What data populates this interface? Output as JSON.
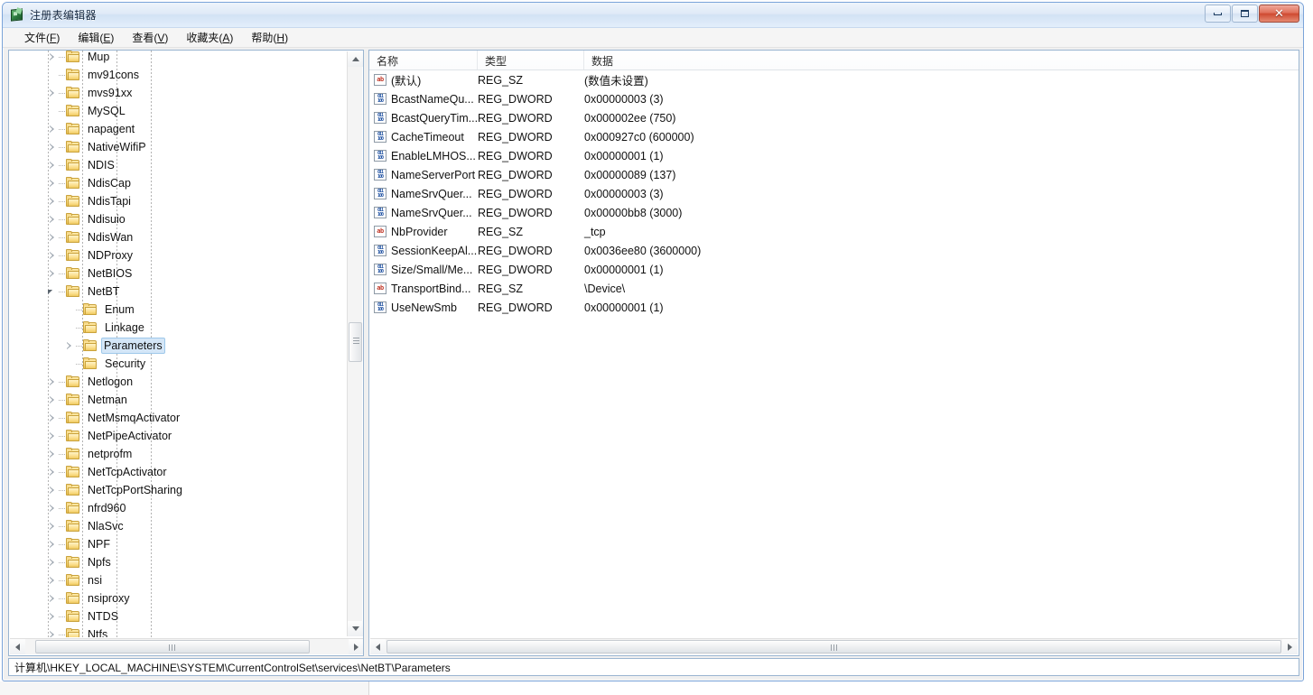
{
  "window": {
    "title": "注册表编辑器",
    "icon": "registry-editor-icon",
    "buttons": {
      "minimize": "",
      "maximize": "",
      "close": "✕"
    }
  },
  "menu": [
    {
      "label": "文件(F)",
      "text": "文件",
      "accel": "F"
    },
    {
      "label": "编辑(E)",
      "text": "编辑",
      "accel": "E"
    },
    {
      "label": "查看(V)",
      "text": "查看",
      "accel": "V"
    },
    {
      "label": "收藏夹(A)",
      "text": "收藏夹",
      "accel": "A"
    },
    {
      "label": "帮助(H)",
      "text": "帮助",
      "accel": "H"
    }
  ],
  "tree": {
    "items": [
      {
        "label": "Mup",
        "depth": 2,
        "twisty": "collapsed",
        "selected": false
      },
      {
        "label": "mv91cons",
        "depth": 2,
        "twisty": "none",
        "selected": false
      },
      {
        "label": "mvs91xx",
        "depth": 2,
        "twisty": "collapsed",
        "selected": false
      },
      {
        "label": "MySQL",
        "depth": 2,
        "twisty": "none",
        "selected": false
      },
      {
        "label": "napagent",
        "depth": 2,
        "twisty": "collapsed",
        "selected": false
      },
      {
        "label": "NativeWifiP",
        "depth": 2,
        "twisty": "collapsed",
        "selected": false
      },
      {
        "label": "NDIS",
        "depth": 2,
        "twisty": "collapsed",
        "selected": false
      },
      {
        "label": "NdisCap",
        "depth": 2,
        "twisty": "collapsed",
        "selected": false
      },
      {
        "label": "NdisTapi",
        "depth": 2,
        "twisty": "collapsed",
        "selected": false
      },
      {
        "label": "Ndisuio",
        "depth": 2,
        "twisty": "collapsed",
        "selected": false
      },
      {
        "label": "NdisWan",
        "depth": 2,
        "twisty": "collapsed",
        "selected": false
      },
      {
        "label": "NDProxy",
        "depth": 2,
        "twisty": "collapsed",
        "selected": false
      },
      {
        "label": "NetBIOS",
        "depth": 2,
        "twisty": "collapsed",
        "selected": false
      },
      {
        "label": "NetBT",
        "depth": 2,
        "twisty": "expanded",
        "selected": false
      },
      {
        "label": "Enum",
        "depth": 3,
        "twisty": "none",
        "selected": false
      },
      {
        "label": "Linkage",
        "depth": 3,
        "twisty": "none",
        "selected": false
      },
      {
        "label": "Parameters",
        "depth": 3,
        "twisty": "collapsed",
        "selected": true
      },
      {
        "label": "Security",
        "depth": 3,
        "twisty": "none",
        "selected": false
      },
      {
        "label": "Netlogon",
        "depth": 2,
        "twisty": "collapsed",
        "selected": false
      },
      {
        "label": "Netman",
        "depth": 2,
        "twisty": "collapsed",
        "selected": false
      },
      {
        "label": "NetMsmqActivator",
        "depth": 2,
        "twisty": "collapsed",
        "selected": false
      },
      {
        "label": "NetPipeActivator",
        "depth": 2,
        "twisty": "collapsed",
        "selected": false
      },
      {
        "label": "netprofm",
        "depth": 2,
        "twisty": "collapsed",
        "selected": false
      },
      {
        "label": "NetTcpActivator",
        "depth": 2,
        "twisty": "collapsed",
        "selected": false
      },
      {
        "label": "NetTcpPortSharing",
        "depth": 2,
        "twisty": "collapsed",
        "selected": false
      },
      {
        "label": "nfrd960",
        "depth": 2,
        "twisty": "collapsed",
        "selected": false
      },
      {
        "label": "NlaSvc",
        "depth": 2,
        "twisty": "collapsed",
        "selected": false
      },
      {
        "label": "NPF",
        "depth": 2,
        "twisty": "collapsed",
        "selected": false
      },
      {
        "label": "Npfs",
        "depth": 2,
        "twisty": "collapsed",
        "selected": false
      },
      {
        "label": "nsi",
        "depth": 2,
        "twisty": "collapsed",
        "selected": false
      },
      {
        "label": "nsiproxy",
        "depth": 2,
        "twisty": "collapsed",
        "selected": false
      },
      {
        "label": "NTDS",
        "depth": 2,
        "twisty": "collapsed",
        "selected": false
      },
      {
        "label": "Ntfs",
        "depth": 2,
        "twisty": "collapsed",
        "selected": false
      }
    ]
  },
  "list": {
    "columns": [
      {
        "label": "名称",
        "key": "name"
      },
      {
        "label": "类型",
        "key": "type"
      },
      {
        "label": "数据",
        "key": "data"
      }
    ],
    "rows": [
      {
        "icon": "string-value-icon",
        "kind": "sz",
        "name": "(默认)",
        "type": "REG_SZ",
        "data": "(数值未设置)"
      },
      {
        "icon": "dword-value-icon",
        "kind": "dw",
        "name": "BcastNameQu...",
        "type": "REG_DWORD",
        "data": "0x00000003 (3)"
      },
      {
        "icon": "dword-value-icon",
        "kind": "dw",
        "name": "BcastQueryTim...",
        "type": "REG_DWORD",
        "data": "0x000002ee (750)"
      },
      {
        "icon": "dword-value-icon",
        "kind": "dw",
        "name": "CacheTimeout",
        "type": "REG_DWORD",
        "data": "0x000927c0 (600000)"
      },
      {
        "icon": "dword-value-icon",
        "kind": "dw",
        "name": "EnableLMHOS...",
        "type": "REG_DWORD",
        "data": "0x00000001 (1)"
      },
      {
        "icon": "dword-value-icon",
        "kind": "dw",
        "name": "NameServerPort",
        "type": "REG_DWORD",
        "data": "0x00000089 (137)"
      },
      {
        "icon": "dword-value-icon",
        "kind": "dw",
        "name": "NameSrvQuer...",
        "type": "REG_DWORD",
        "data": "0x00000003 (3)"
      },
      {
        "icon": "dword-value-icon",
        "kind": "dw",
        "name": "NameSrvQuer...",
        "type": "REG_DWORD",
        "data": "0x00000bb8 (3000)"
      },
      {
        "icon": "string-value-icon",
        "kind": "sz",
        "name": "NbProvider",
        "type": "REG_SZ",
        "data": "_tcp"
      },
      {
        "icon": "dword-value-icon",
        "kind": "dw",
        "name": "SessionKeepAl...",
        "type": "REG_DWORD",
        "data": "0x0036ee80 (3600000)"
      },
      {
        "icon": "dword-value-icon",
        "kind": "dw",
        "name": "Size/Small/Me...",
        "type": "REG_DWORD",
        "data": "0x00000001 (1)"
      },
      {
        "icon": "string-value-icon",
        "kind": "sz",
        "name": "TransportBind...",
        "type": "REG_SZ",
        "data": "\\Device\\"
      },
      {
        "icon": "dword-value-icon",
        "kind": "dw",
        "name": "UseNewSmb",
        "type": "REG_DWORD",
        "data": "0x00000001 (1)"
      }
    ]
  },
  "status": {
    "path": "计算机\\HKEY_LOCAL_MACHINE\\SYSTEM\\CurrentControlSet\\services\\NetBT\\Parameters"
  },
  "colors": {
    "selection": "#d4e6f7",
    "selection_border": "#9ec8ea",
    "window_border": "#7ba4d9",
    "close_button": "#cf4a31",
    "string_icon": "#c23a2b",
    "dword_icon": "#1c4fa0"
  }
}
